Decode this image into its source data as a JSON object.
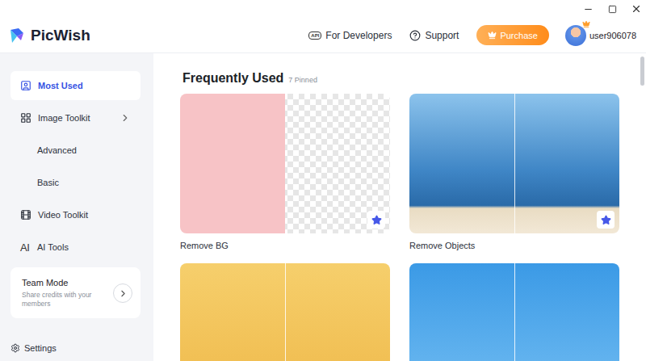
{
  "header": {
    "brand": "PicWish",
    "links": [
      {
        "label": "For Developers",
        "icon": "API"
      },
      {
        "label": "Support"
      }
    ],
    "purchase": "Purchase",
    "user": "user906078"
  },
  "sidebar": {
    "items": [
      {
        "label": "Most Used",
        "kind": "top",
        "selected": true
      },
      {
        "label": "Image Toolkit",
        "kind": "group",
        "selected": false
      },
      {
        "label": "Advanced",
        "kind": "sub",
        "selected": false
      },
      {
        "label": "Basic",
        "kind": "sub",
        "selected": false
      },
      {
        "label": "Video Toolkit",
        "kind": "video",
        "selected": false
      },
      {
        "label": "AI Tools",
        "kind": "ai",
        "icon": "AI",
        "selected": false
      }
    ],
    "team": {
      "title": "Team Mode",
      "subtitle": "Share credits with your members"
    },
    "settings": "Settings"
  },
  "main": {
    "title": "Frequently Used",
    "count": "7 Pinned",
    "cards": [
      {
        "label": "Remove BG",
        "starred": true
      },
      {
        "label": "Remove Objects",
        "starred": true
      },
      {
        "label": "",
        "starred": false
      },
      {
        "label": "",
        "starred": false
      }
    ]
  }
}
